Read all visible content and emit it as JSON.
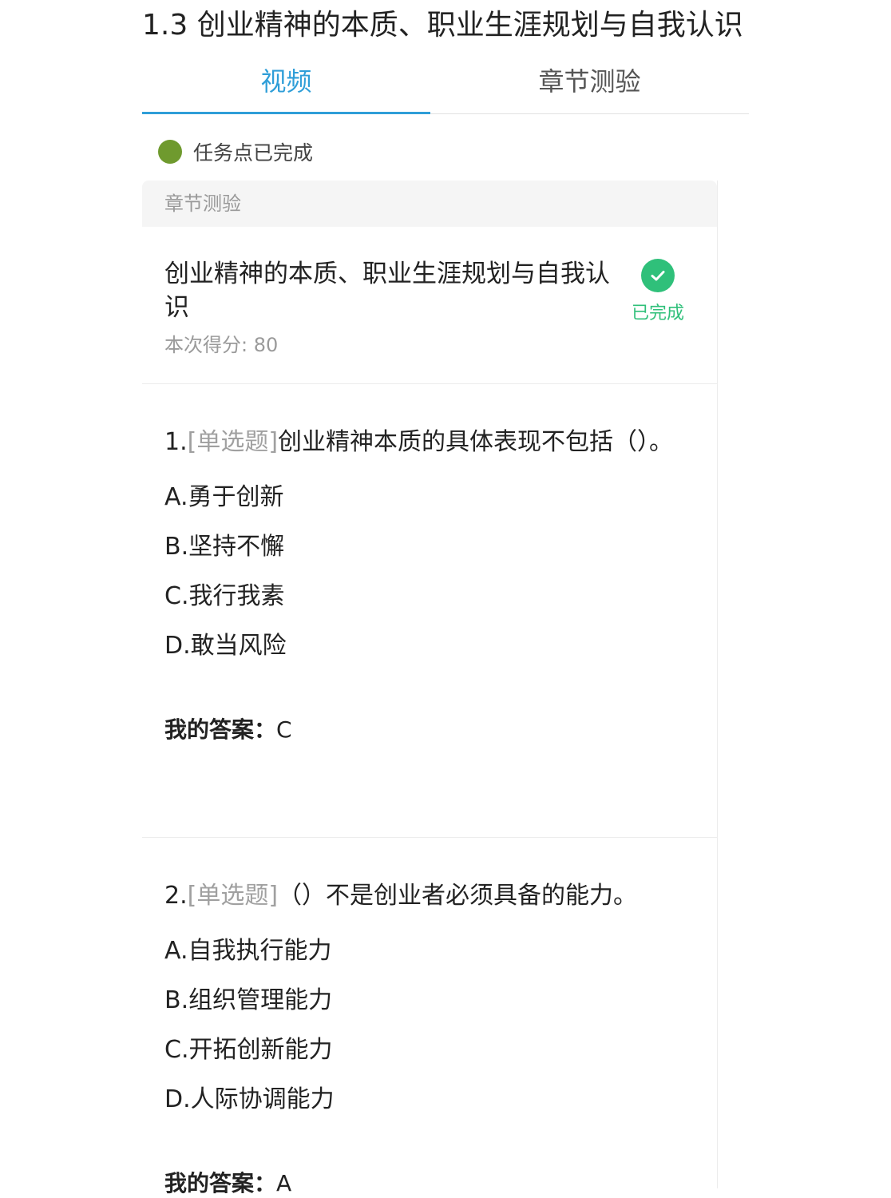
{
  "page": {
    "title": "1.3 创业精神的本质、职业生涯规划与自我认识"
  },
  "tabs": {
    "video": "视频",
    "quiz": "章节测验"
  },
  "task": {
    "status": "任务点已完成",
    "dot_color": "#6f9a2e"
  },
  "card": {
    "header": "章节测验",
    "quiz_title": "创业精神的本质、职业生涯规划与自我认识",
    "score_label": "本次得分:",
    "score_value": "80",
    "done_label": "已完成",
    "done_color": "#2fc07a"
  },
  "questions": [
    {
      "number": "1.",
      "type": "[单选题]",
      "text": "创业精神本质的具体表现不包括（）。",
      "options": [
        "A.勇于创新",
        "B.坚持不懈",
        "C.我行我素",
        "D.敢当风险"
      ],
      "answer_label": "我的答案：",
      "answer_value": "C"
    },
    {
      "number": "2.",
      "type": "[单选题]",
      "text": "（）不是创业者必须具备的能力。",
      "options": [
        "A.自我执行能力",
        "B.组织管理能力",
        "C.开拓创新能力",
        "D.人际协调能力"
      ],
      "answer_label": "我的答案：",
      "answer_value": "A"
    }
  ],
  "colors": {
    "accent": "#2f9ed8",
    "muted": "#a0a0a0"
  }
}
